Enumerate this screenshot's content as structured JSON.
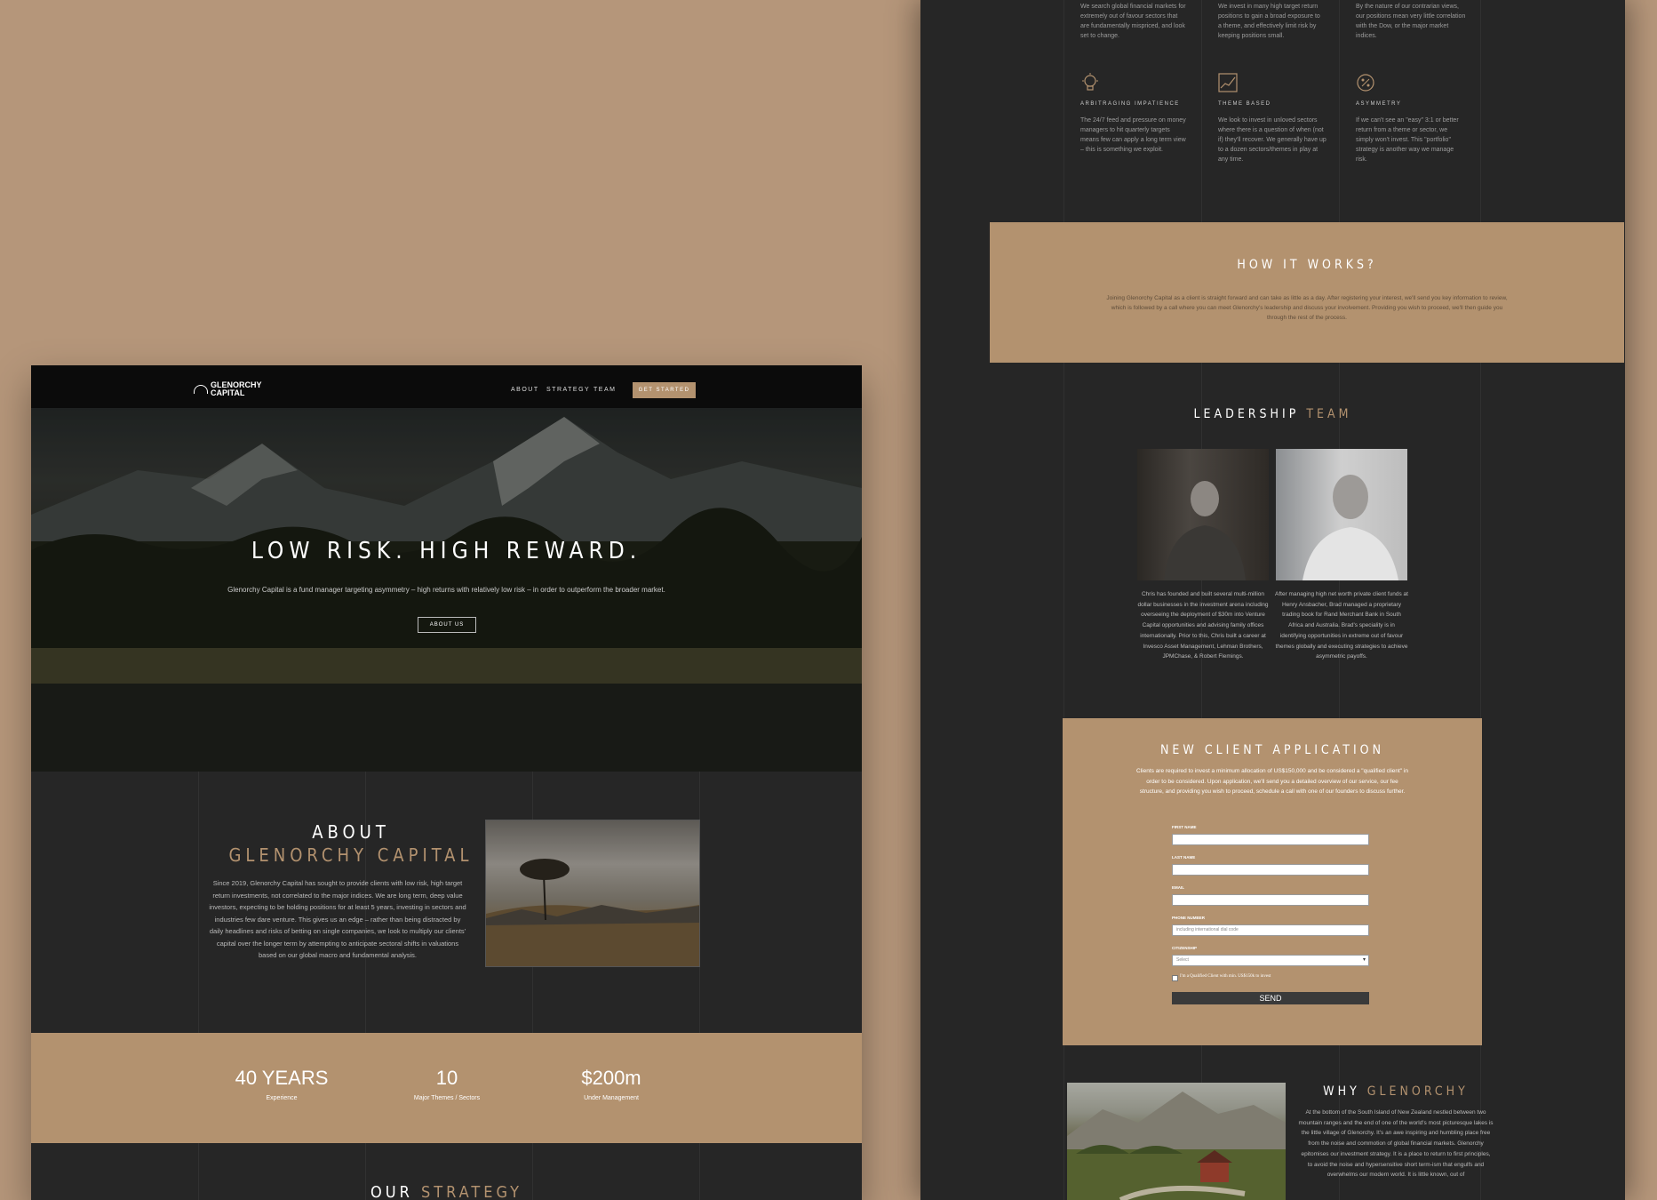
{
  "colors": {
    "background": "#b5967a",
    "dark": "#262626",
    "accent": "#b3926f",
    "nav": "#0b0b0b"
  },
  "left": {
    "nav": {
      "logo_line1": "GLENORCHY",
      "logo_line2": "CAPITAL",
      "links": [
        "ABOUT",
        "STRATEGY",
        "TEAM"
      ],
      "cta": "GET STARTED"
    },
    "hero": {
      "title": "LOW RISK. HIGH REWARD.",
      "subtitle": "Glenorchy Capital is a fund manager targeting asymmetry – high returns with relatively low risk – in order to outperform the broader market.",
      "button": "ABOUT US"
    },
    "about": {
      "heading1": "ABOUT",
      "heading2": "GLENORCHY CAPITAL",
      "body": "Since 2019, Glenorchy Capital has sought to provide clients with low risk, high target return investments, not correlated to the major indices. We are long term, deep value investors, expecting to be holding positions for at least 5 years, investing in sectors and industries few dare venture. This gives us an edge – rather than being distracted by daily headlines and risks of betting on single companies, we look to multiply our clients' capital over the longer term by attempting to anticipate sectoral shifts in valuations based on our global macro and fundamental analysis."
    },
    "stats": [
      {
        "value": "40 YEARS",
        "label": "Experience"
      },
      {
        "value": "10",
        "label": "Major Themes / Sectors"
      },
      {
        "value": "$200m",
        "label": "Under Management"
      }
    ],
    "strategy": {
      "part1": "OUR",
      "part2": "STRATEGY"
    }
  },
  "right": {
    "top_texts": [
      "We search global financial markets for extremely out of favour sectors that are fundamentally mispriced, and look set to change.",
      "We invest in many high target return positions to gain a broad exposure to a theme, and effectively limit risk by keeping positions small.",
      "By the nature of our contrarian views, our positions mean very little correlation with the Dow, or the major market indices."
    ],
    "features": [
      {
        "title": "ARBITRAGING IMPATIENCE",
        "icon": "lightbulb-icon",
        "body": "The 24/7 feed and pressure on money managers to hit quarterly targets means few can apply a long term view – this is something we exploit."
      },
      {
        "title": "THEME BASED",
        "icon": "chart-icon",
        "body": "We look to invest in unloved sectors where there is a question of when (not if) they'll recover. We generally have up to a dozen sectors/themes in play at any time."
      },
      {
        "title": "ASYMMETRY",
        "icon": "percent-icon",
        "body": "If we can't see an \"easy\" 3:1 or better return from a theme or sector, we simply won't invest. This \"portfolio\" strategy is another way we manage risk."
      }
    ],
    "how": {
      "heading1": "HOW IT",
      "heading2": "WORKS?",
      "body": "Joining Glenorchy Capital as a client is straight forward and can take as little as a day. After registering your interest, we'll send you key information to review, which is followed by a call where you can meet Glenorchy's leadership and discuss your involvement. Providing you wish to proceed, we'll then guide you through the rest of the process."
    },
    "leadership": {
      "heading1": "LEADERSHIP",
      "heading2": "TEAM",
      "bios": [
        "Chris has founded and built several multi-million dollar businesses in the investment arena including overseeing the deployment of $30m into Venture Capital opportunities and advising family offices internationally. Prior to this, Chris built a career at Invesco Asset Management, Lehman Brothers, JPMChase, & Robert Flemings.",
        "After managing high net worth private client funds at Henry Ansbacher, Brad managed a proprietary trading book for Rand Merchant Bank in South Africa and Australia. Brad's speciality is in identifying opportunities in extreme out of favour themes globally and executing strategies to achieve asymmetric payoffs."
      ]
    },
    "application": {
      "heading": "NEW CLIENT APPLICATION",
      "body": "Clients are required to invest a minimum allocation of US$150,000 and be considered a \"qualified client\" in order to be considered. Upon application, we'll send you a detailed overview of our service, our fee structure, and providing you wish to proceed, schedule a call with one of our founders to discuss further.",
      "fields": {
        "first_name": "FIRST NAME",
        "last_name": "LAST NAME",
        "email": "EMAIL",
        "phone": "PHONE NUMBER",
        "phone_placeholder": "including international dial code",
        "citizenship": "CITIZENSHIP",
        "citizenship_value": "Select"
      },
      "checkbox_label": "I'm a Qualified Client with min. US$150k to invest",
      "send": "SEND"
    },
    "why": {
      "heading1": "WHY",
      "heading2": "GLENORCHY",
      "body": "At the bottom of the South Island of New Zealand nestled between two mountain ranges and the end of one of the world's most picturesque lakes is the little village of Glenorchy. It's an awe inspiring and humbling place free from the noise and commotion of global financial markets. Glenorchy epitomises our investment strategy. It is a place to return to first principles, to avoid the noise and hypersensitive short term-ism that engulfs and overwhelms our modern world. It is little known, out of"
    }
  }
}
